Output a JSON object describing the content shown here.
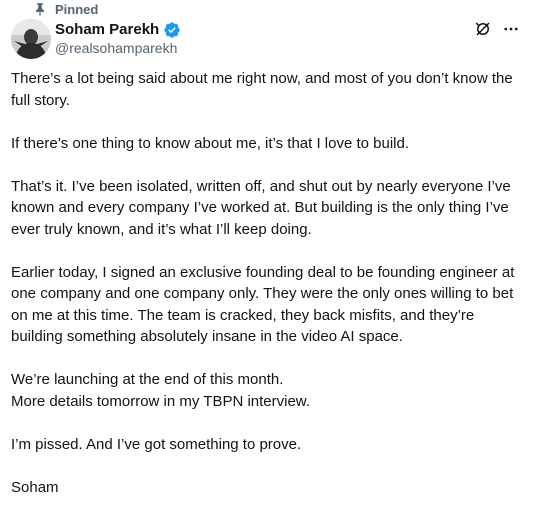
{
  "pinned_label": "Pinned",
  "author": {
    "name": "Soham Parekh",
    "handle": "@realsohamparekh"
  },
  "icons": {
    "pin": "pin-icon",
    "verified": "verified-badge-icon",
    "grok": "grok-icon",
    "more": "more-options-icon"
  },
  "colors": {
    "verified": "#1d9bf0",
    "secondary_text": "#536471"
  },
  "post": {
    "paragraphs": [
      "There’s a lot being said about me right now, and most of you don’t know the full story.",
      "If there’s one thing to know about me, it’s that I love to build.",
      "That’s it. I’ve been isolated, written off, and shut out by nearly everyone I’ve known and every company I’ve worked at. But building is the only thing I’ve ever truly known, and it’s what I’ll keep doing.",
      "Earlier today, I signed an exclusive founding deal to be founding engineer at one company and one company only. They were the only ones willing to bet on me at this time. The team is cracked, they back misfits, and they’re building something absolutely insane in the video AI space.",
      "We’re launching at the end of this month.\nMore details tomorrow in my TBPN interview.",
      "I’m pissed. And I’ve got something to prove.",
      "Soham"
    ]
  }
}
